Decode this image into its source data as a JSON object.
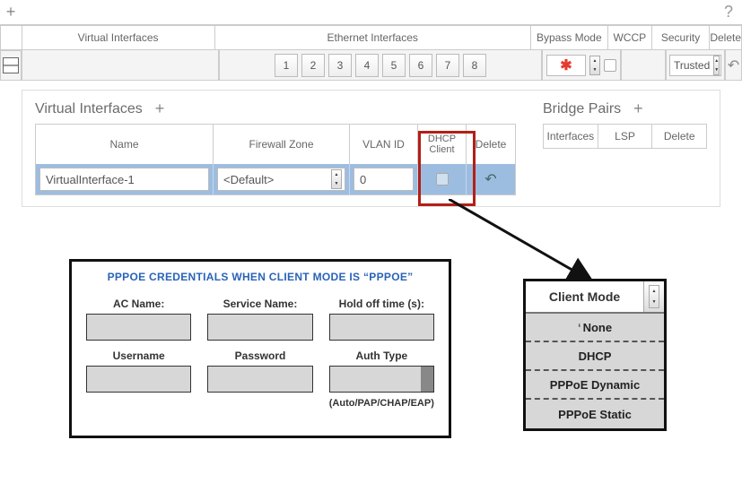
{
  "top": {
    "plus": "+",
    "help": "?"
  },
  "headers": {
    "virtual_interfaces": "Virtual Interfaces",
    "ethernet_interfaces": "Ethernet Interfaces",
    "bypass_mode": "Bypass Mode",
    "wccp": "WCCP",
    "security": "Security",
    "delete": "Delete"
  },
  "ports": [
    "1",
    "2",
    "3",
    "4",
    "5",
    "6",
    "7",
    "8"
  ],
  "bypass_value": "✱",
  "security_value": "Trusted",
  "toggle": "—",
  "vi_section": {
    "title": "Virtual Interfaces",
    "cols": {
      "name": "Name",
      "zone": "Firewall Zone",
      "vlan": "VLAN ID",
      "dhcp_line1": "DHCP",
      "dhcp_line2": "Client",
      "delete": "Delete"
    },
    "row": {
      "name": "VirtualInterface-1",
      "zone": "<Default>",
      "vlan": "0"
    }
  },
  "bp_section": {
    "title": "Bridge Pairs",
    "cols": {
      "interfaces": "Interfaces",
      "lsp": "LSP",
      "delete": "Delete"
    }
  },
  "pppoe": {
    "title": "PPPOE CREDENTIALS WHEN CLIENT MODE IS “PPPOE”",
    "ac_name": "AC Name:",
    "service_name": "Service Name:",
    "hold_off": "Hold off time (s):",
    "username": "Username",
    "password": "Password",
    "auth_type": "Auth Type",
    "auth_hint": "(Auto/PAP/CHAP/EAP)"
  },
  "client_mode": {
    "label": "Client Mode",
    "options": [
      "None",
      "DHCP",
      "PPPoE Dynamic",
      "PPPoE Static"
    ]
  }
}
